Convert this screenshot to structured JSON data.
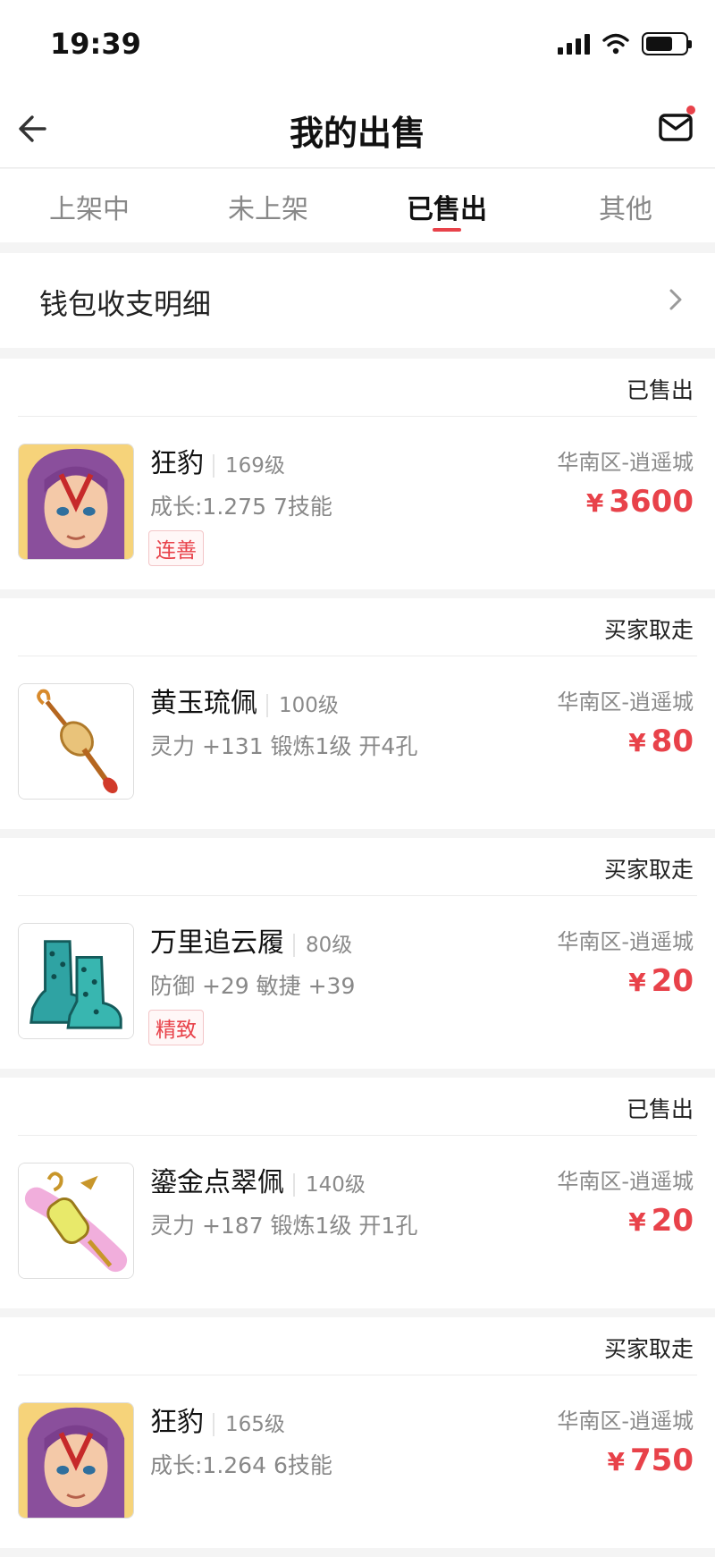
{
  "status_bar": {
    "time": "19:39"
  },
  "nav": {
    "title": "我的出售"
  },
  "tabs": [
    {
      "label": "上架中",
      "active": false
    },
    {
      "label": "未上架",
      "active": false
    },
    {
      "label": "已售出",
      "active": true
    },
    {
      "label": "其他",
      "active": false
    }
  ],
  "wallet": {
    "label": "钱包收支明细"
  },
  "orders": [
    {
      "status": "已售出",
      "name": "狂豹",
      "level": "169级",
      "attrs": "成长:1.275 7技能",
      "tag": "连善",
      "server": "华南区-逍遥城",
      "currency": "¥",
      "price": "3600",
      "thumb": "character-portrait"
    },
    {
      "status": "买家取走",
      "name": "黄玉琉佩",
      "level": "100级",
      "attrs": "灵力 +131 锻炼1级 开4孔",
      "tag": "",
      "server": "华南区-逍遥城",
      "currency": "¥",
      "price": "80",
      "thumb": "jade-pendant"
    },
    {
      "status": "买家取走",
      "name": "万里追云履",
      "level": "80级",
      "attrs": "防御 +29 敏捷 +39",
      "tag": "精致",
      "server": "华南区-逍遥城",
      "currency": "¥",
      "price": "20",
      "thumb": "boots"
    },
    {
      "status": "已售出",
      "name": "鎏金点翠佩",
      "level": "140级",
      "attrs": "灵力 +187 锻炼1级 开1孔",
      "tag": "",
      "server": "华南区-逍遥城",
      "currency": "¥",
      "price": "20",
      "thumb": "gold-pendant"
    },
    {
      "status": "买家取走",
      "name": "狂豹",
      "level": "165级",
      "attrs": "成长:1.264 6技能",
      "tag": "",
      "server": "华南区-逍遥城",
      "currency": "¥",
      "price": "750",
      "thumb": "character-portrait"
    }
  ],
  "colors": {
    "accent": "#e8424a",
    "muted": "#8a8a8a",
    "background": "#f4f4f4"
  }
}
